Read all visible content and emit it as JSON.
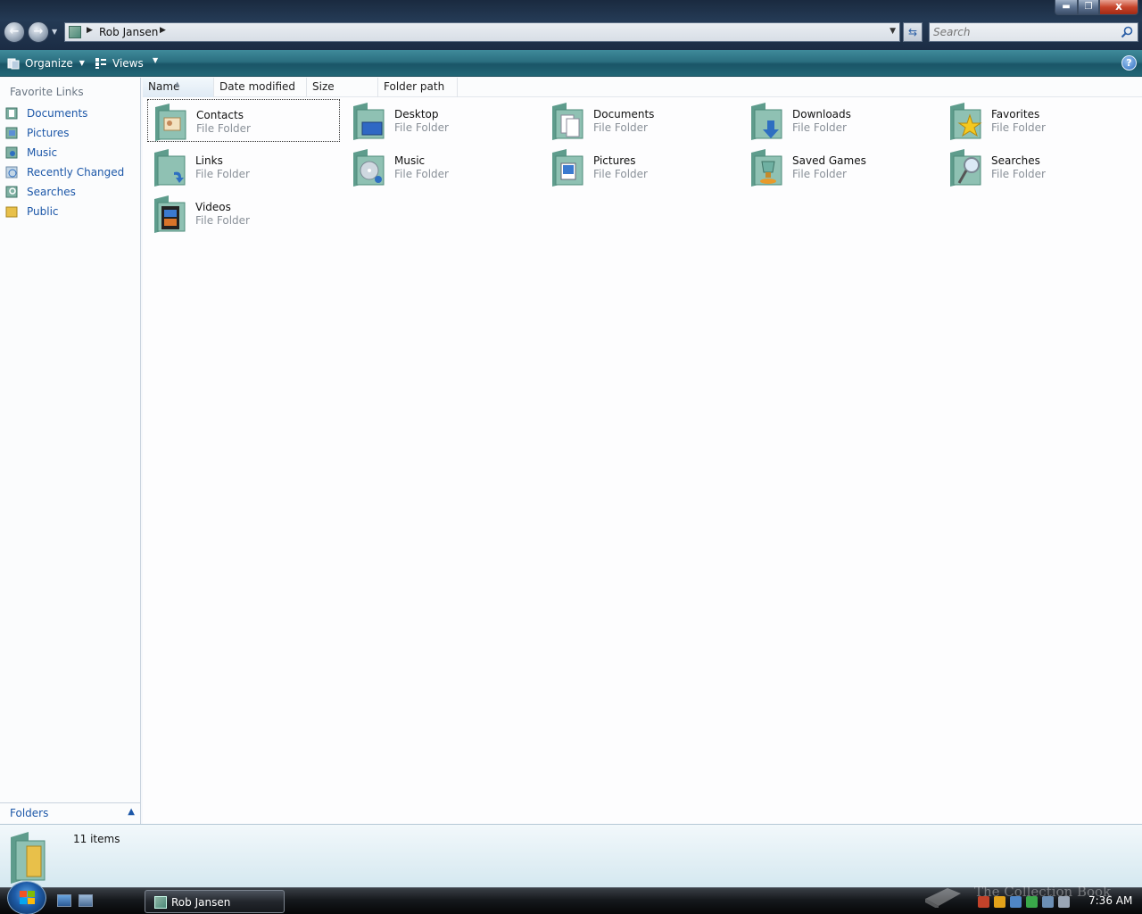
{
  "window": {
    "address": "Rob Jansen",
    "search_placeholder": "Search",
    "minimize": "",
    "maximize": "",
    "close": "x"
  },
  "toolbar": {
    "organize_label": "Organize",
    "views_label": "Views",
    "help_label": "?"
  },
  "nav_pane": {
    "title": "Favorite Links",
    "links": [
      {
        "label": "Documents",
        "icon": "documents-icon"
      },
      {
        "label": "Pictures",
        "icon": "pictures-icon"
      },
      {
        "label": "Music",
        "icon": "music-icon"
      },
      {
        "label": "Recently Changed",
        "icon": "recently-changed-icon"
      },
      {
        "label": "Searches",
        "icon": "searches-icon"
      },
      {
        "label": "Public",
        "icon": "public-folder-icon"
      }
    ],
    "folders_label": "Folders"
  },
  "columns": [
    "Name",
    "Date modified",
    "Size",
    "Folder path"
  ],
  "items": [
    {
      "name": "Contacts",
      "type": "File Folder",
      "icon": "contacts-folder-icon",
      "selected": true
    },
    {
      "name": "Desktop",
      "type": "File Folder",
      "icon": "desktop-folder-icon"
    },
    {
      "name": "Documents",
      "type": "File Folder",
      "icon": "documents-folder-icon"
    },
    {
      "name": "Downloads",
      "type": "File Folder",
      "icon": "downloads-folder-icon"
    },
    {
      "name": "Favorites",
      "type": "File Folder",
      "icon": "favorites-folder-icon"
    },
    {
      "name": "Links",
      "type": "File Folder",
      "icon": "links-folder-icon"
    },
    {
      "name": "Music",
      "type": "File Folder",
      "icon": "music-folder-icon"
    },
    {
      "name": "Pictures",
      "type": "File Folder",
      "icon": "pictures-folder-icon"
    },
    {
      "name": "Saved Games",
      "type": "File Folder",
      "icon": "saved-games-folder-icon"
    },
    {
      "name": "Searches",
      "type": "File Folder",
      "icon": "searches-folder-icon"
    },
    {
      "name": "Videos",
      "type": "File Folder",
      "icon": "videos-folder-icon"
    }
  ],
  "details": {
    "count": "11 items"
  },
  "taskbar": {
    "task_label": "Rob Jansen",
    "clock": "7:36 AM",
    "watermark": "The Collection Book"
  },
  "colors": {
    "link_blue": "#1c57a8",
    "toolbar_teal": "#2b6f80",
    "folder_green": "#6fa89a"
  }
}
